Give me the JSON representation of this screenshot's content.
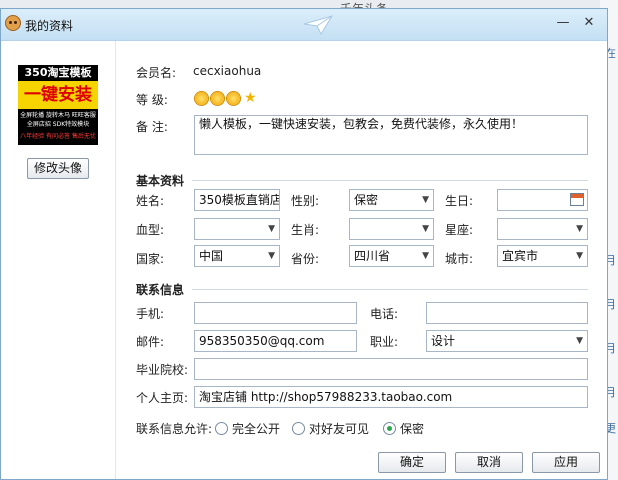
{
  "background": {
    "title_fragment": "千年头条",
    "side_fragments": [
      "在",
      "月",
      "月",
      "月",
      "月",
      "更"
    ]
  },
  "window": {
    "title": "我的资料",
    "minimize_glyph": "—",
    "close_glyph": "✕",
    "accent_color": "#c4e0f4"
  },
  "profile": {
    "avatar": {
      "top_text": "350淘宝模板",
      "main_text": "一键安装",
      "line1": "全屏轮播 旋转木马 旺旺客服",
      "line2": "全屏店招 SDK特效模块",
      "bottom_text": "八年经验 有问必答 售后无忧"
    },
    "change_avatar_label": "修改头像",
    "member_label": "会员名:",
    "member_value": "cecxiaohua",
    "level_label": "等  级:",
    "level_icons": [
      "sun-icon",
      "sun-icon",
      "sun-icon",
      "star-icon"
    ],
    "note_label": "备  注:",
    "note_value": "懒人模板，一键快速安装，包教会，免费代装修，永久使用！"
  },
  "basic": {
    "section_title": "基本资料",
    "name_label": "姓名:",
    "name_value": "350模板直销店",
    "gender_label": "性别:",
    "gender_value": "保密",
    "birthday_label": "生日:",
    "birthday_value": "",
    "blood_label": "血型:",
    "blood_value": "",
    "zodiac_label": "生肖:",
    "zodiac_value": "",
    "star_label": "星座:",
    "star_value": "",
    "country_label": "国家:",
    "country_value": "中国",
    "province_label": "省份:",
    "province_value": "四川省",
    "city_label": "城市:",
    "city_value": "宜宾市"
  },
  "contact": {
    "section_title": "联系信息",
    "mobile_label": "手机:",
    "mobile_value": "",
    "phone_label": "电话:",
    "phone_value": "",
    "email_label": "邮件:",
    "email_value": "958350350@qq.com",
    "job_label": "职业:",
    "job_value": "设计",
    "school_label": "毕业院校:",
    "school_value": "",
    "homepage_label": "个人主页:",
    "homepage_value": "淘宝店铺 http://shop57988233.taobao.com",
    "visibility_label": "联系信息允许:",
    "visibility_options": [
      "完全公开",
      "对好友可见",
      "保密"
    ],
    "visibility_selected": 2
  },
  "buttons": {
    "ok": "确定",
    "cancel": "取消",
    "apply": "应用"
  },
  "colors": {
    "radio_checked": "#2aa84a",
    "avatar_yellow": "#f5d400",
    "avatar_red": "#e00000"
  }
}
